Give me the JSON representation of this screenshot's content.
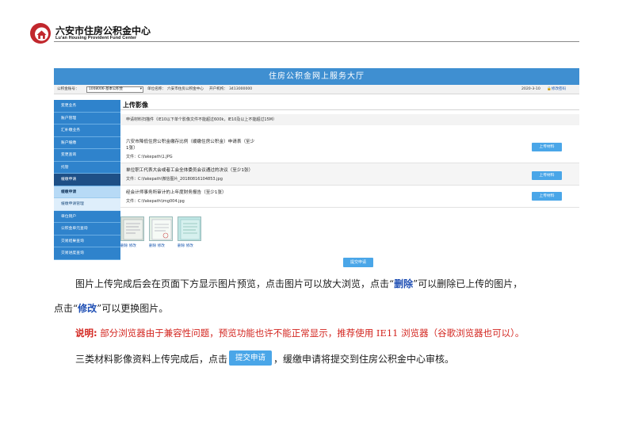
{
  "letterhead": {
    "org_cn": "六安市住房公积金中心",
    "org_en": "Lu'an Housing Provident Fund Center",
    "brand_color": "#c1272d"
  },
  "portal": {
    "banner_title": "住房公积金网上服务大厅",
    "info": {
      "account_label": "公积金账号：",
      "account_value": "1008006-基本公积金",
      "unit_label": "单位名称：",
      "unit_value": "六安市住房公积金中心",
      "bank_label": "开户机构：",
      "bank_value": "3413000000",
      "date": "2020-3-10",
      "password_link": "修改密码"
    },
    "sidebar": [
      "变更业务",
      "账户管理",
      "汇补缴业务",
      "账户缓缴",
      "变更查询",
      "托管",
      "缓缴申请",
      "缓缴申请",
      "缓缴申请管理",
      "单位销户",
      "公积金单元查询",
      "交易结果查询",
      "交易进度查询"
    ],
    "main": {
      "title": "上传影像",
      "hint": "申请材料扫描件（IE10以下单个影像文件不能超过600k，IE10及以上不能超过15M）",
      "materials": [
        {
          "title_line1": "六安市降低住房公积金缴存比例（缓缴住房公积金）申请表（至少",
          "title_line2": "1张）",
          "file": "文件：C:\\fakepath\\1.JPG",
          "button": "上传材料"
        },
        {
          "title_line1": "单位职工代表大会或者工会全体委员会议通过的决议（至少1张）",
          "file": "文件：C:\\fakepath\\微信图片_20180816104853.jpg",
          "button": "上传材料"
        },
        {
          "title_line1": "经会计师事务所审计的上年度财务报告（至少1张）",
          "file": "文件：C:\\fakepath\\img004.jpg",
          "button": "上传材料"
        }
      ],
      "thumbs": [
        {
          "delete": "删除",
          "edit": "修改"
        },
        {
          "delete": "删除",
          "edit": "修改"
        },
        {
          "delete": "删除",
          "edit": "修改"
        }
      ],
      "submit": "提交申请"
    }
  },
  "doc": {
    "p1_a": "图片上传完成后会在页面下方显示图片预览，点击图片可以放大浏览，点击“",
    "p1_delete": "删除",
    "p1_b": "”可以删除已上传的图片，",
    "p2_a": "点击“",
    "p2_edit": "修改",
    "p2_b": "”可以更换图片。",
    "note_label": "说明:",
    "note_text": "部分浏览器由于兼容性问题，预览功能也许不能正常显示，推荐使用 IE11 浏览器（谷歌浏览器也可以）。",
    "p4_a": "三类材料影像资料上传完成后，点击",
    "p4_button": "提交申请",
    "p4_b": "，缓缴申请将提交到住房公积金中心审核。"
  }
}
